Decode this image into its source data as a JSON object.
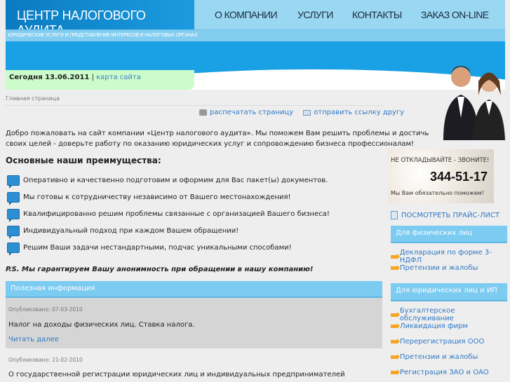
{
  "header": {
    "title": "ЦЕНТР НАЛОГОВОГО АУДИТА",
    "subtitle": "ЮРИДИЧЕСКИЕ УСЛУГИ И ПРЕДСТАВЛЕНИЕ ИНТЕРЕСОВ В НАЛОГОВЫХ ОРГАНАХ",
    "nav": [
      "О КОМПАНИИ",
      "УСЛУГИ",
      "КОНТАКТЫ",
      "ЗАКАЗ ON-LINE"
    ],
    "today": "Сегодня 13.06.2011",
    "sep": "|",
    "sitemap": "карта сайта"
  },
  "breadcrumb": "Главная страница",
  "tools": {
    "print": "распечатать страницу",
    "send": "отправить ссылку другу"
  },
  "intro": [
    "Добро пожаловать на сайт компании «Центр налогового аудита». Мы поможем Вам решить проблемы и достичь",
    "своих целей - доверьте работу по оказанию юридических услуг и сопровождению бизнеса профессионалам!"
  ],
  "advantages": {
    "title": "Основные наши преимущества:",
    "items": [
      "Оперативно и качественно подготовим и оформим для Вас пакет(ы) документов.",
      "Мы готовы к сотрудничеству независимо от Вашего местонахождения!",
      "Квалифицированно решим проблемы связанные с организацией Вашего бизнеса!",
      "Индивидуальный подход при каждом Вашем обращении!",
      "Решим Ваши задачи нестандартными, подчас уникальными способами!"
    ]
  },
  "ps": "P.S. Мы гарантируем Вашу анонимность при обращении в нашу компанию!",
  "news": {
    "title": "Полезная информация",
    "items": [
      {
        "meta": "Опубликовано: 07-03-2010",
        "title": "Налог на доходы физических лиц. Ставка налога.",
        "more": "Читать далее"
      },
      {
        "meta": "Опубликовано: 21-02-2010",
        "title": "О государственной регистрации юридических лиц и индивидуальных предпринимателей"
      }
    ]
  },
  "sidebar": {
    "banner": {
      "top": "НЕ ОТКЛАДЫВАЙТЕ - ЗВОНИТЕ!",
      "phone": "344-51-17",
      "bottom": "Мы Вам обязательно поможем!"
    },
    "price": "ПОСМОТРЕТЬ ПРАЙС-ЛИСТ",
    "sections": [
      {
        "title": "Для физических лиц",
        "items": [
          "Декларация по форме 3-НДФЛ",
          "Претензии и жалобы"
        ]
      },
      {
        "title": "Для юридических лиц и ИП",
        "items": [
          "Бухгалтерское обслуживание",
          "Ликвидация фирм",
          "Перерегистрация ООО",
          "Претензии и жалобы",
          "Регистрация ЗАО и ОАО"
        ]
      }
    ]
  }
}
